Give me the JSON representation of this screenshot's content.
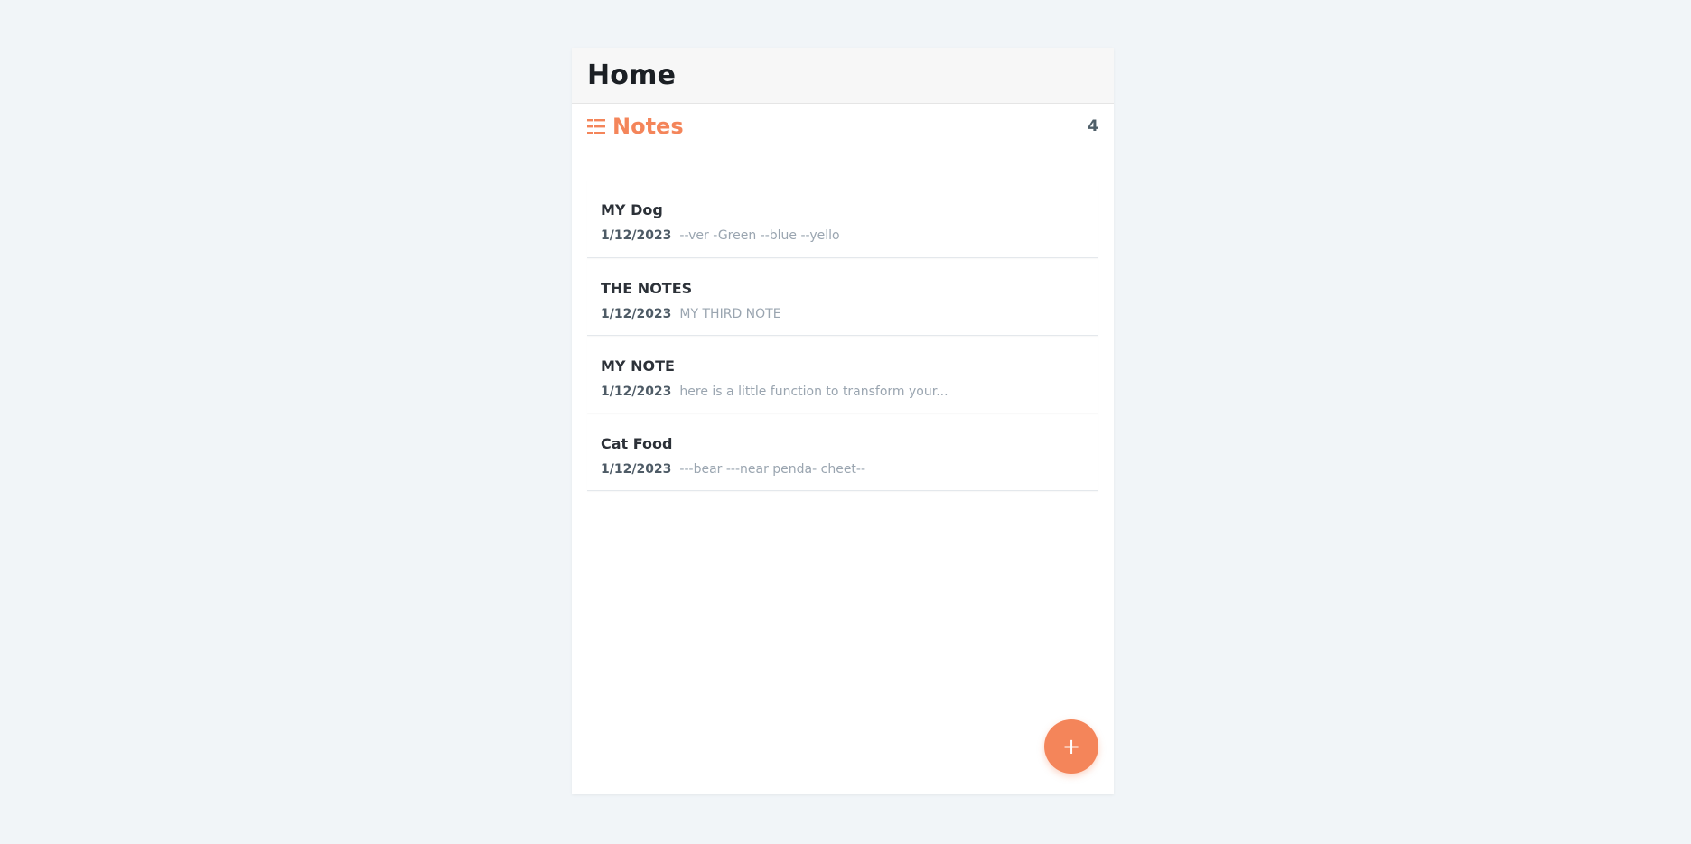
{
  "header": {
    "title": "Home"
  },
  "section": {
    "title": "Notes",
    "count": "4",
    "icon": "list-icon",
    "accent_color": "#f4855a"
  },
  "notes": [
    {
      "title": "MY Dog",
      "date": "1/12/2023",
      "preview": "--ver -Green --blue --yello"
    },
    {
      "title": "THE NOTES",
      "date": "1/12/2023",
      "preview": "MY THIRD NOTE"
    },
    {
      "title": "MY NOTE",
      "date": "1/12/2023",
      "preview": "here is a little function to transform your..."
    },
    {
      "title": "Cat Food",
      "date": "1/12/2023",
      "preview": "---bear ---near penda- cheet--"
    }
  ],
  "fab": {
    "label": "+",
    "icon": "plus-icon"
  }
}
